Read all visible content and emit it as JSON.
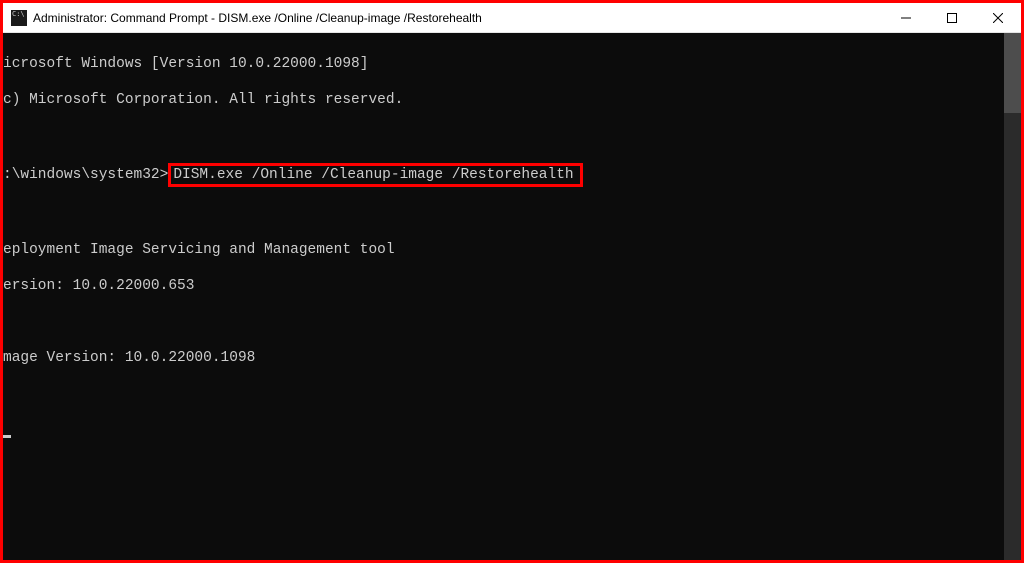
{
  "window": {
    "title": "Administrator: Command Prompt - DISM.exe  /Online /Cleanup-image /Restorehealth"
  },
  "console": {
    "line1": "icrosoft Windows [Version 10.0.22000.1098]",
    "line2": "c) Microsoft Corporation. All rights reserved.",
    "prompt": ":\\windows\\system32>",
    "command": "DISM.exe /Online /Cleanup-image /Restorehealth",
    "tool_line": "eployment Image Servicing and Management tool",
    "version_line": "ersion: 10.0.22000.653",
    "image_version_line": "mage Version: 10.0.22000.1098"
  }
}
